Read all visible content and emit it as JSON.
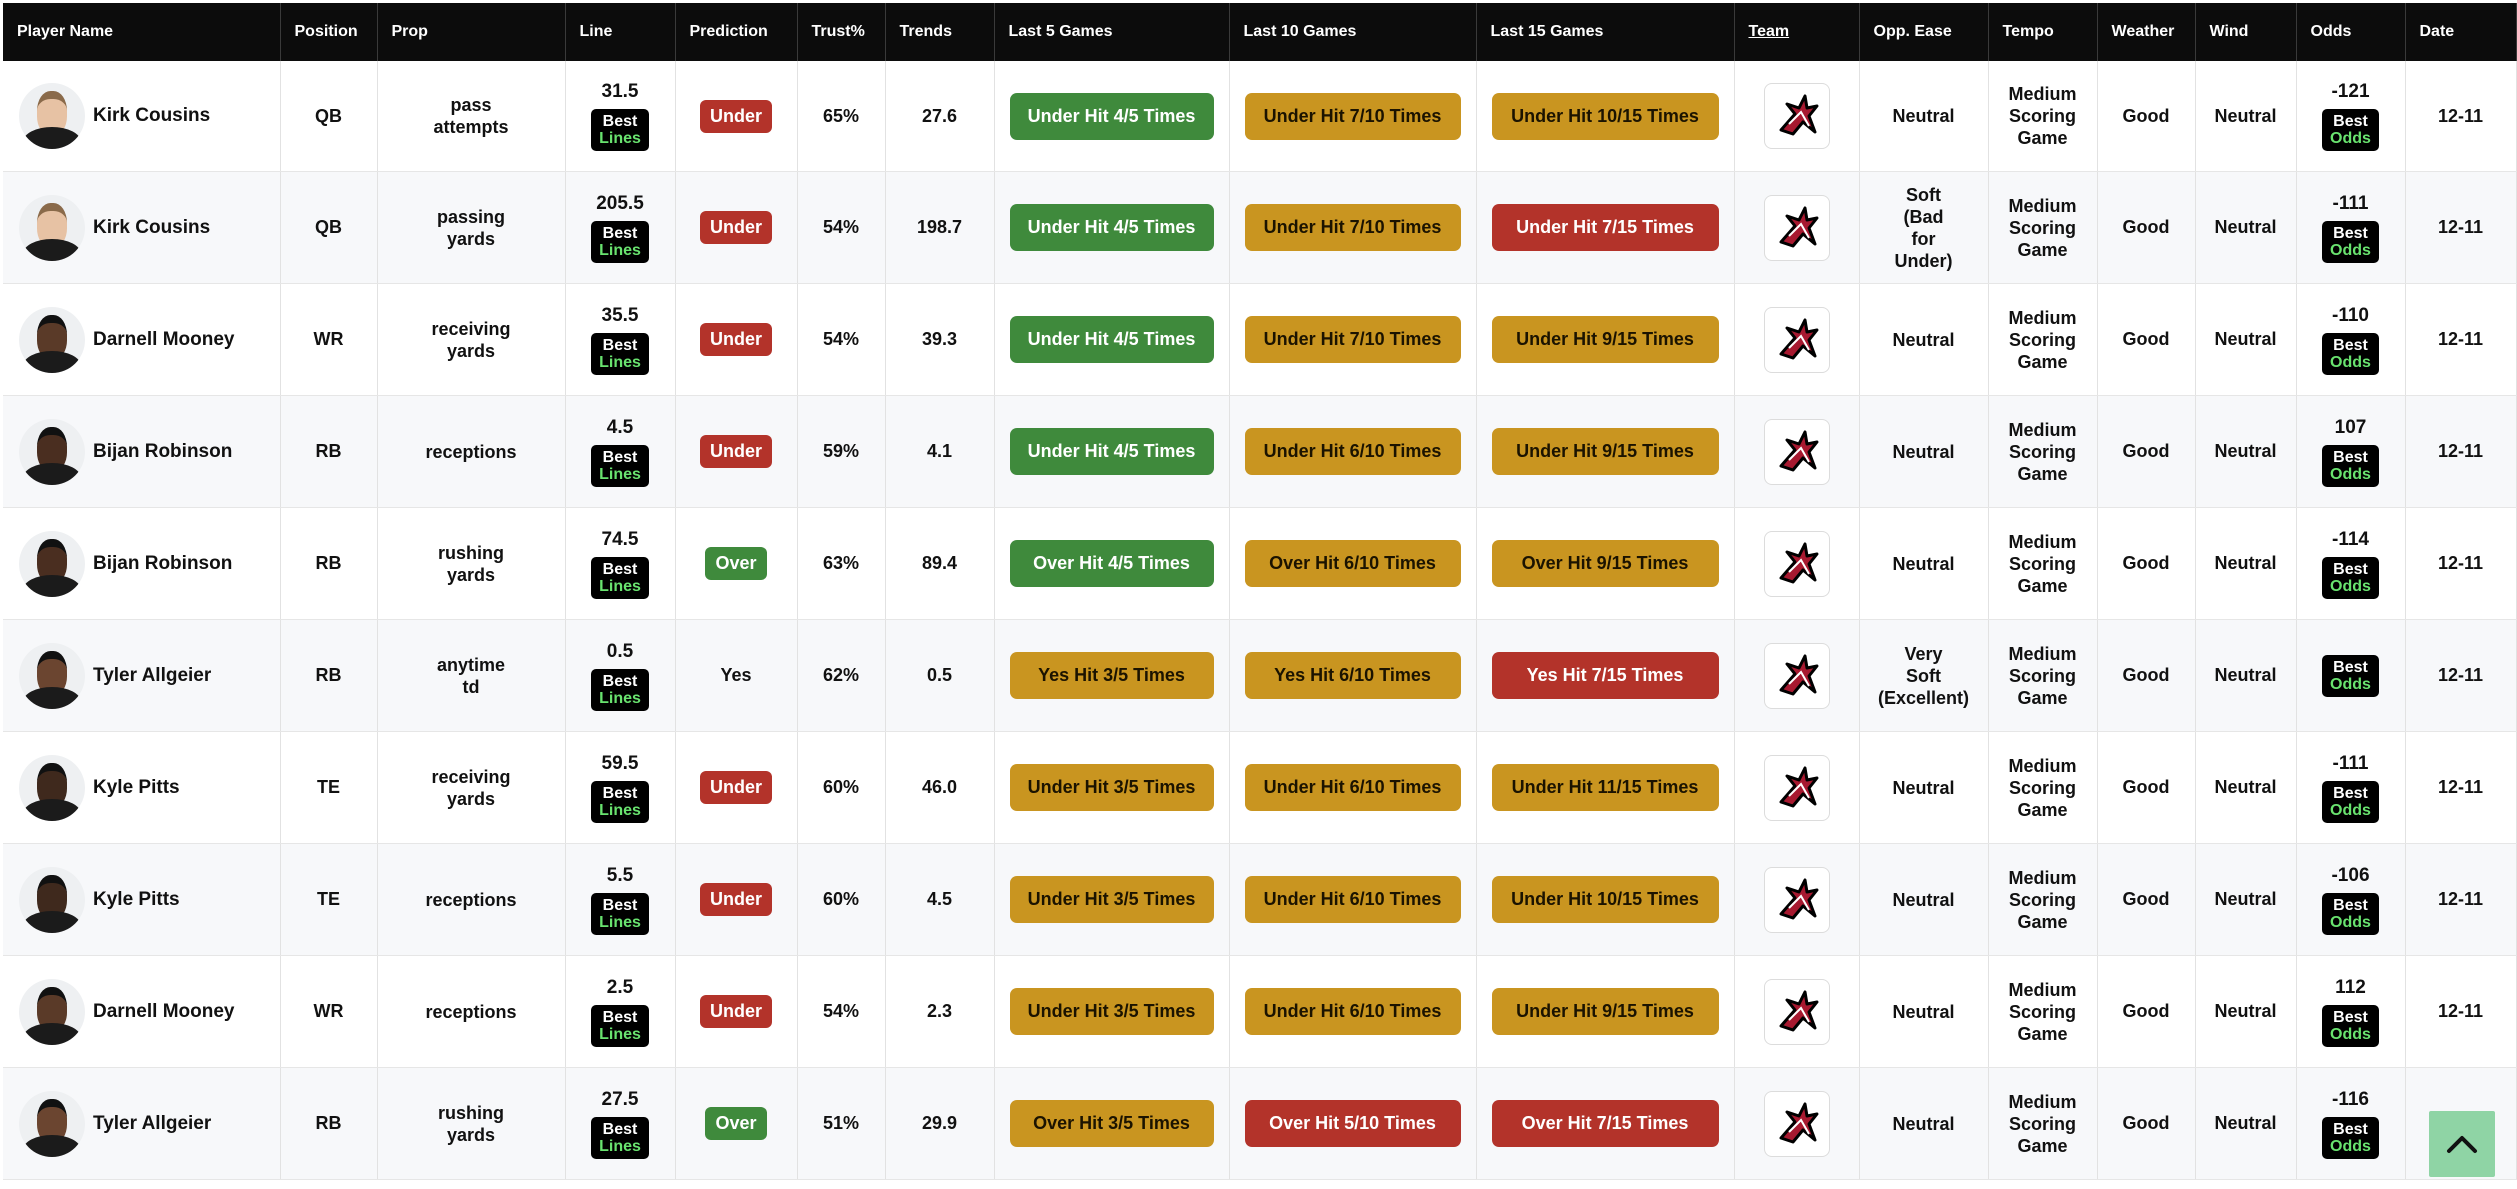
{
  "headers": {
    "player_name": "Player Name",
    "position": "Position",
    "prop": "Prop",
    "line": "Line",
    "prediction": "Prediction",
    "trust": "Trust%",
    "trends": "Trends",
    "last5": "Last 5 Games",
    "last10": "Last 10 Games",
    "last15": "Last 15 Games",
    "team": "Team",
    "opp_ease": "Opp. Ease",
    "tempo": "Tempo",
    "weather": "Weather",
    "wind": "Wind",
    "odds": "Odds",
    "date": "Date"
  },
  "best_lines": {
    "top": "Best",
    "bottom": "Lines"
  },
  "best_odds": {
    "top": "Best",
    "bottom": "Odds"
  },
  "colors": {
    "green": "#3f8a3c",
    "yellow": "#c99520",
    "red": "#b3332a",
    "header_bg": "#0c0c0c",
    "scroll_button": "#8fd4a5"
  },
  "icons": {
    "team_logo": "falcons-logo-icon",
    "scroll_top": "chevron-up-icon"
  },
  "rows": [
    {
      "player": "Kirk Cousins",
      "position": "QB",
      "prop": [
        "pass",
        "attempts"
      ],
      "line": "31.5",
      "prediction": "Under",
      "prediction_type": "under",
      "trust": "65%",
      "trends": "27.6",
      "last5": "Under Hit 4/5 Times",
      "last5_color": "green",
      "last10": "Under Hit 7/10 Times",
      "last10_color": "yellow",
      "last15": "Under Hit 10/15 Times",
      "last15_color": "yellow",
      "opp_ease": [
        "Neutral"
      ],
      "tempo": [
        "Medium",
        "Scoring",
        "Game"
      ],
      "weather": "Good",
      "wind": "Neutral",
      "odds": "-121",
      "date": "12-11"
    },
    {
      "player": "Kirk Cousins",
      "position": "QB",
      "prop": [
        "passing",
        "yards"
      ],
      "line": "205.5",
      "prediction": "Under",
      "prediction_type": "under",
      "trust": "54%",
      "trends": "198.7",
      "last5": "Under Hit 4/5 Times",
      "last5_color": "green",
      "last10": "Under Hit 7/10 Times",
      "last10_color": "yellow",
      "last15": "Under Hit 7/15 Times",
      "last15_color": "red",
      "opp_ease": [
        "Soft",
        "(Bad",
        "for",
        "Under)"
      ],
      "tempo": [
        "Medium",
        "Scoring",
        "Game"
      ],
      "weather": "Good",
      "wind": "Neutral",
      "odds": "-111",
      "date": "12-11"
    },
    {
      "player": "Darnell Mooney",
      "position": "WR",
      "prop": [
        "receiving",
        "yards"
      ],
      "line": "35.5",
      "prediction": "Under",
      "prediction_type": "under",
      "trust": "54%",
      "trends": "39.3",
      "last5": "Under Hit 4/5 Times",
      "last5_color": "green",
      "last10": "Under Hit 7/10 Times",
      "last10_color": "yellow",
      "last15": "Under Hit 9/15 Times",
      "last15_color": "yellow",
      "opp_ease": [
        "Neutral"
      ],
      "tempo": [
        "Medium",
        "Scoring",
        "Game"
      ],
      "weather": "Good",
      "wind": "Neutral",
      "odds": "-110",
      "date": "12-11"
    },
    {
      "player": "Bijan Robinson",
      "position": "RB",
      "prop": [
        "receptions"
      ],
      "line": "4.5",
      "prediction": "Under",
      "prediction_type": "under",
      "trust": "59%",
      "trends": "4.1",
      "last5": "Under Hit 4/5 Times",
      "last5_color": "green",
      "last10": "Under Hit 6/10 Times",
      "last10_color": "yellow",
      "last15": "Under Hit 9/15 Times",
      "last15_color": "yellow",
      "opp_ease": [
        "Neutral"
      ],
      "tempo": [
        "Medium",
        "Scoring",
        "Game"
      ],
      "weather": "Good",
      "wind": "Neutral",
      "odds": "107",
      "date": "12-11"
    },
    {
      "player": "Bijan Robinson",
      "position": "RB",
      "prop": [
        "rushing",
        "yards"
      ],
      "line": "74.5",
      "prediction": "Over",
      "prediction_type": "over",
      "trust": "63%",
      "trends": "89.4",
      "last5": "Over Hit 4/5 Times",
      "last5_color": "green",
      "last10": "Over Hit 6/10 Times",
      "last10_color": "yellow",
      "last15": "Over Hit 9/15 Times",
      "last15_color": "yellow",
      "opp_ease": [
        "Neutral"
      ],
      "tempo": [
        "Medium",
        "Scoring",
        "Game"
      ],
      "weather": "Good",
      "wind": "Neutral",
      "odds": "-114",
      "date": "12-11"
    },
    {
      "player": "Tyler Allgeier",
      "position": "RB",
      "prop": [
        "anytime",
        "td"
      ],
      "line": "0.5",
      "prediction": "Yes",
      "prediction_type": "plain",
      "trust": "62%",
      "trends": "0.5",
      "last5": "Yes Hit 3/5 Times",
      "last5_color": "yellow",
      "last10": "Yes Hit 6/10 Times",
      "last10_color": "yellow",
      "last15": "Yes Hit 7/15 Times",
      "last15_color": "red",
      "opp_ease": [
        "Very",
        "Soft",
        "(Excellent)"
      ],
      "tempo": [
        "Medium",
        "Scoring",
        "Game"
      ],
      "weather": "Good",
      "wind": "Neutral",
      "odds": "",
      "date": "12-11"
    },
    {
      "player": "Kyle Pitts",
      "position": "TE",
      "prop": [
        "receiving",
        "yards"
      ],
      "line": "59.5",
      "prediction": "Under",
      "prediction_type": "under",
      "trust": "60%",
      "trends": "46.0",
      "last5": "Under Hit 3/5 Times",
      "last5_color": "yellow",
      "last10": "Under Hit 6/10 Times",
      "last10_color": "yellow",
      "last15": "Under Hit 11/15 Times",
      "last15_color": "yellow",
      "opp_ease": [
        "Neutral"
      ],
      "tempo": [
        "Medium",
        "Scoring",
        "Game"
      ],
      "weather": "Good",
      "wind": "Neutral",
      "odds": "-111",
      "date": "12-11"
    },
    {
      "player": "Kyle Pitts",
      "position": "TE",
      "prop": [
        "receptions"
      ],
      "line": "5.5",
      "prediction": "Under",
      "prediction_type": "under",
      "trust": "60%",
      "trends": "4.5",
      "last5": "Under Hit 3/5 Times",
      "last5_color": "yellow",
      "last10": "Under Hit 6/10 Times",
      "last10_color": "yellow",
      "last15": "Under Hit 10/15 Times",
      "last15_color": "yellow",
      "opp_ease": [
        "Neutral"
      ],
      "tempo": [
        "Medium",
        "Scoring",
        "Game"
      ],
      "weather": "Good",
      "wind": "Neutral",
      "odds": "-106",
      "date": "12-11"
    },
    {
      "player": "Darnell Mooney",
      "position": "WR",
      "prop": [
        "receptions"
      ],
      "line": "2.5",
      "prediction": "Under",
      "prediction_type": "under",
      "trust": "54%",
      "trends": "2.3",
      "last5": "Under Hit 3/5 Times",
      "last5_color": "yellow",
      "last10": "Under Hit 6/10 Times",
      "last10_color": "yellow",
      "last15": "Under Hit 9/15 Times",
      "last15_color": "yellow",
      "opp_ease": [
        "Neutral"
      ],
      "tempo": [
        "Medium",
        "Scoring",
        "Game"
      ],
      "weather": "Good",
      "wind": "Neutral",
      "odds": "112",
      "date": "12-11"
    },
    {
      "player": "Tyler Allgeier",
      "position": "RB",
      "prop": [
        "rushing",
        "yards"
      ],
      "line": "27.5",
      "prediction": "Over",
      "prediction_type": "over",
      "trust": "51%",
      "trends": "29.9",
      "last5": "Over Hit 3/5 Times",
      "last5_color": "yellow",
      "last10": "Over Hit 5/10 Times",
      "last10_color": "red",
      "last15": "Over Hit 7/15 Times",
      "last15_color": "red",
      "opp_ease": [
        "Neutral"
      ],
      "tempo": [
        "Medium",
        "Scoring",
        "Game"
      ],
      "weather": "Good",
      "wind": "Neutral",
      "odds": "-116",
      "date": ""
    }
  ]
}
